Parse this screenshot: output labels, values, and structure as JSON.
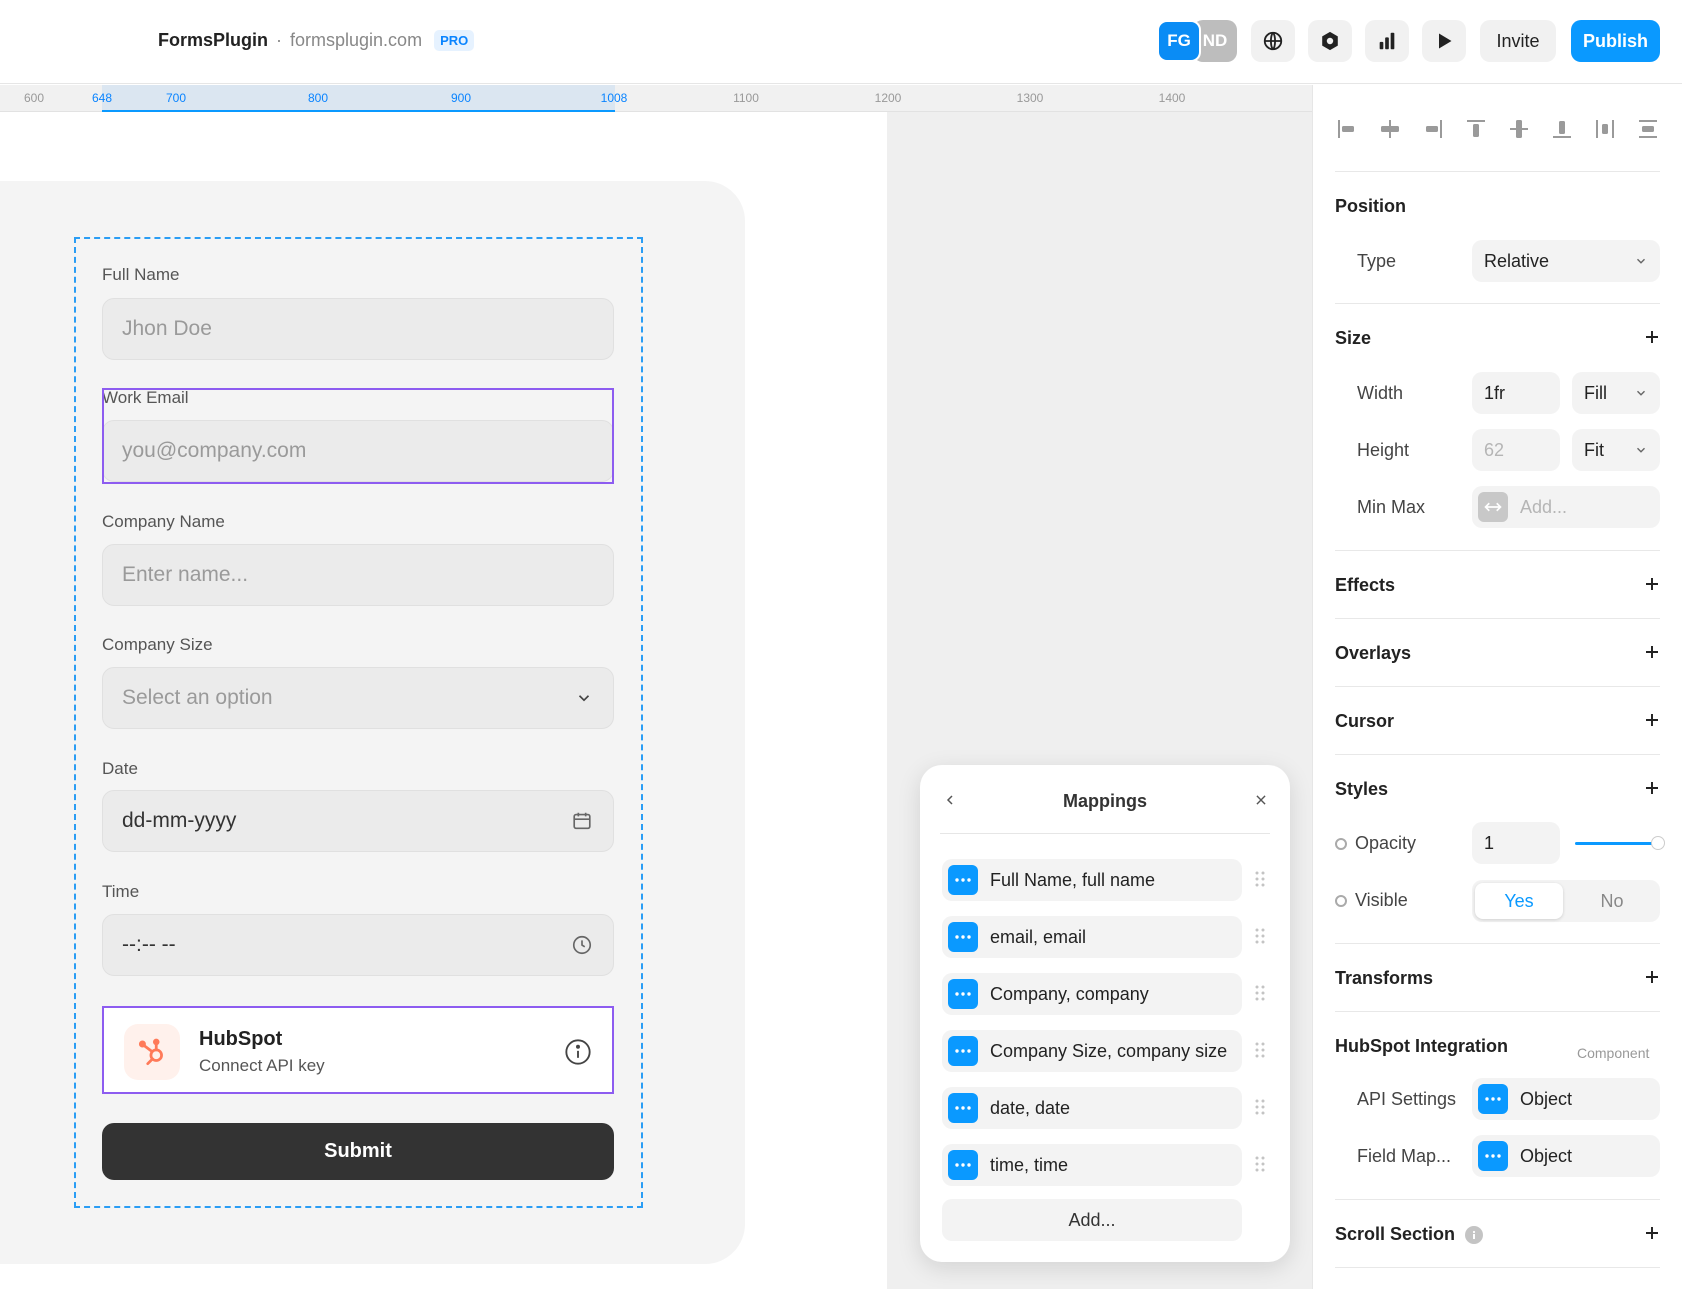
{
  "topbar": {
    "app_name": "FormsPlugin",
    "separator": "·",
    "domain": "formsplugin.com",
    "badge": "PRO",
    "avatars": [
      "FG",
      "ND"
    ],
    "icons": [
      "globe-icon",
      "hexagon-icon",
      "analytics-icon",
      "play-icon"
    ],
    "invite_label": "Invite",
    "publish_label": "Publish"
  },
  "ruler": {
    "ticks": [
      "600",
      "648",
      "700",
      "800",
      "900",
      "1008",
      "1100",
      "1200",
      "1300",
      "1400"
    ],
    "highlighted_ticks": [
      "648",
      "700",
      "800",
      "900",
      "1008"
    ]
  },
  "form": {
    "fields": [
      {
        "label": "Full Name",
        "placeholder": "Jhon Doe"
      },
      {
        "label": "Work Email",
        "placeholder": "you@company.com"
      },
      {
        "label": "Company Name",
        "placeholder": "Enter name..."
      },
      {
        "label": "Company Size",
        "placeholder": "Select an option"
      },
      {
        "label": "Date",
        "placeholder": "dd-mm-yyyy"
      },
      {
        "label": "Time",
        "placeholder": "--:-- --"
      }
    ],
    "hubspot": {
      "title": "HubSpot",
      "subtitle": "Connect API key"
    },
    "submit_label": "Submit"
  },
  "mappings": {
    "title": "Mappings",
    "items": [
      "Full Name, full name",
      "email, email",
      "Company, company",
      "Company Size, company size",
      "date, date",
      "time, time"
    ],
    "add_label": "Add..."
  },
  "panel": {
    "position": {
      "title": "Position",
      "type_label": "Type",
      "type_value": "Relative"
    },
    "size": {
      "title": "Size",
      "width_label": "Width",
      "width_value": "1fr",
      "width_mode": "Fill",
      "height_label": "Height",
      "height_value": "62",
      "height_mode": "Fit",
      "minmax_label": "Min Max",
      "minmax_placeholder": "Add..."
    },
    "effects": "Effects",
    "overlays": "Overlays",
    "cursor": "Cursor",
    "styles": {
      "title": "Styles",
      "opacity_label": "Opacity",
      "opacity_value": "1",
      "opacity_level": 1.0,
      "visible_label": "Visible",
      "visible_yes": "Yes",
      "visible_no": "No"
    },
    "transforms": "Transforms",
    "hubspot_integration": {
      "title": "HubSpot Integration",
      "tag": "Component",
      "api_label": "API Settings",
      "api_value": "Object",
      "fieldmap_label": "Field Map...",
      "fieldmap_value": "Object"
    },
    "scroll_section": "Scroll Section"
  },
  "colors": {
    "accent": "#0a99ff",
    "selection_dashed": "#2a9df4",
    "selection_purple": "#8d5cf0",
    "hubspot_orange": "#ff7a59",
    "submit_bg": "#333333"
  }
}
